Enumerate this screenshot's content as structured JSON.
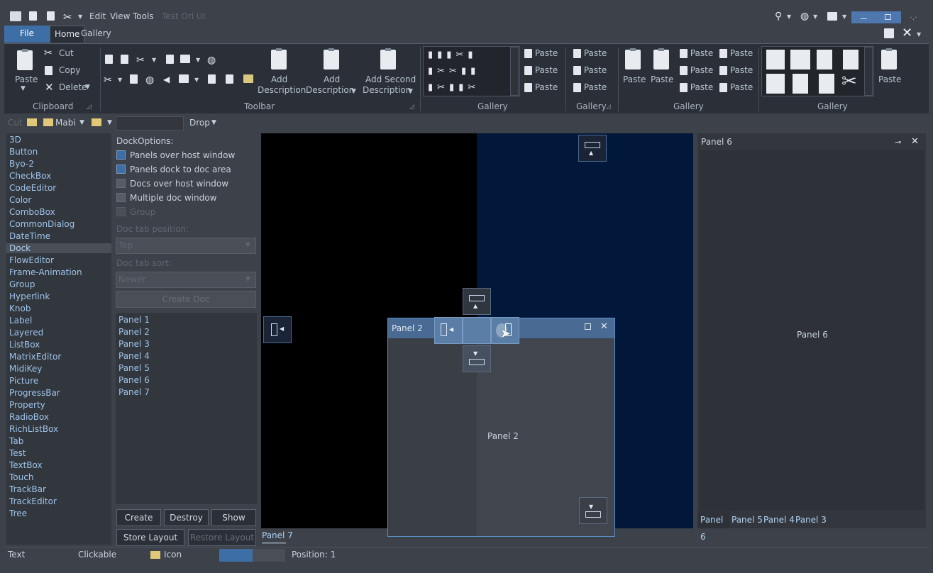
{
  "titlebar": {
    "menus": [
      "Edit",
      "View",
      "Tools"
    ],
    "app_title": "Test Ori UI"
  },
  "tabs": {
    "file": "File",
    "home": "Home",
    "gallery": "Gallery"
  },
  "ribbon": {
    "clipboard": {
      "paste": "Paste",
      "cut": "Cut",
      "copy": "Copy",
      "delete": "Delete",
      "label": "Clipboard"
    },
    "toolbar": {
      "add1": "Add",
      "desc1": "Description",
      "add2": "Add",
      "desc2": "Description",
      "add3": "Add Second",
      "desc3": "Description",
      "label": "Toolbar"
    },
    "gallery1": {
      "paste": "Paste",
      "label": "Gallery"
    },
    "gallery2": {
      "paste": "Paste",
      "label": "Gallery"
    },
    "gallery3": {
      "paste": "Paste",
      "label": "Gallery"
    },
    "gallery4": {
      "paste": "Paste",
      "label": "Gallery"
    }
  },
  "toolbar2": {
    "cut": "Cut",
    "folder": "Mabi",
    "drop": "Drop"
  },
  "left_list": [
    "3D",
    "Button",
    "Byo-2",
    "CheckBox",
    "CodeEditor",
    "Color",
    "ComboBox",
    "CommonDialog",
    "DateTime",
    "Dock",
    "FlowEditor",
    "Frame-Animation",
    "Group",
    "Hyperlink",
    "Knob",
    "Label",
    "Layered",
    "ListBox",
    "MatrixEditor",
    "MidiKey",
    "Picture",
    "ProgressBar",
    "Property",
    "RadioBox",
    "RichListBox",
    "Tab",
    "Test",
    "TextBox",
    "Touch",
    "TrackBar",
    "TrackEditor",
    "Tree"
  ],
  "left_selected": "Dock",
  "options": {
    "title": "DockOptions:",
    "cb1": "Panels over host window",
    "cb2": "Panels dock to doc area",
    "cb3": "Docs over host window",
    "cb4": "Multiple doc window",
    "group": "Group",
    "tabpos_label": "Doc tab position:",
    "tabpos_value": "Top",
    "tabsort_label": "Doc tab sort:",
    "tabsort_value": "Newer",
    "create_doc": "Create Doc"
  },
  "panel_list": [
    "Panel 1",
    "Panel 2",
    "Panel 3",
    "Panel 4",
    "Panel 5",
    "Panel 6",
    "Panel 7"
  ],
  "buttons": {
    "create": "Create",
    "destroy": "Destroy",
    "show": "Show",
    "store": "Store Layout",
    "restore": "Restore Layout"
  },
  "doc_tab": "Panel 7",
  "float_panel": {
    "title": "Panel 2",
    "body": "Panel 2"
  },
  "panel6": {
    "title": "Panel 6",
    "body": "Panel 6",
    "tabs": [
      "Panel 6",
      "Panel 5",
      "Panel 4",
      "Panel 3"
    ]
  },
  "status": {
    "text": "Text",
    "clickable": "Clickable",
    "icon": "Icon",
    "position": "Position: 1",
    "progress": 0.5
  }
}
